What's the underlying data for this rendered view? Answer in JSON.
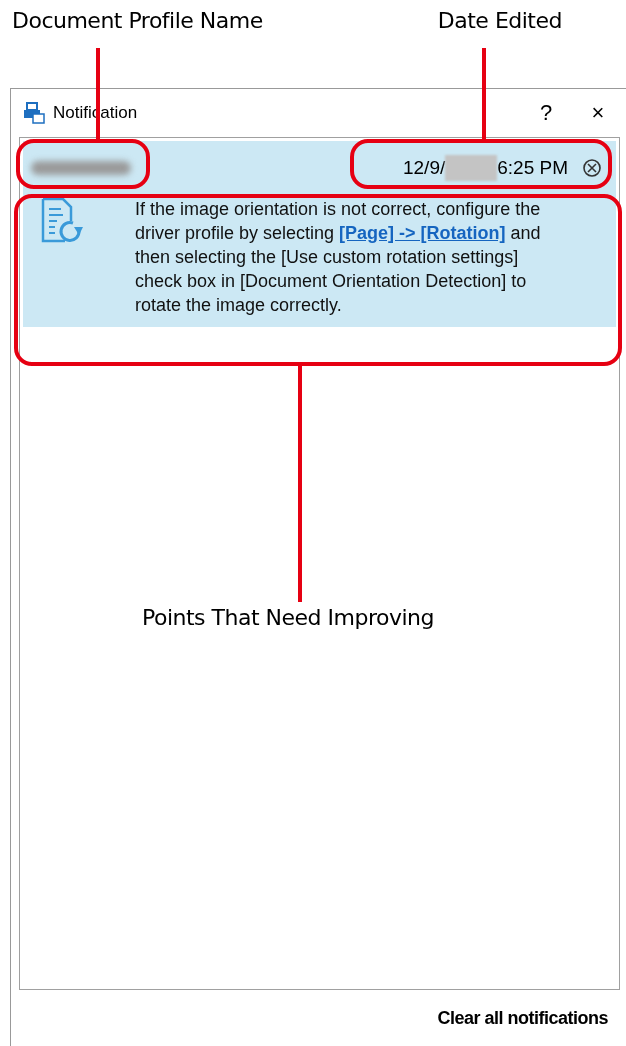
{
  "annotations": {
    "profile_name": "Document Profile Name",
    "date_edited": "Date Edited",
    "points": "Points That Need Improving"
  },
  "window": {
    "title": "Notification",
    "help": "?",
    "close": "×"
  },
  "notification": {
    "date_start": "12/9/",
    "time": "6:25 PM",
    "message_before": "If the image orientation is not correct, configure the driver profile by selecting ",
    "link": "[Page] -> [Rotation]",
    "message_after": " and then selecting the [Use custom rotation settings] check box in [Document Orientation Detection] to rotate the image correctly."
  },
  "footer": {
    "clear_all": "Clear all notifications"
  }
}
